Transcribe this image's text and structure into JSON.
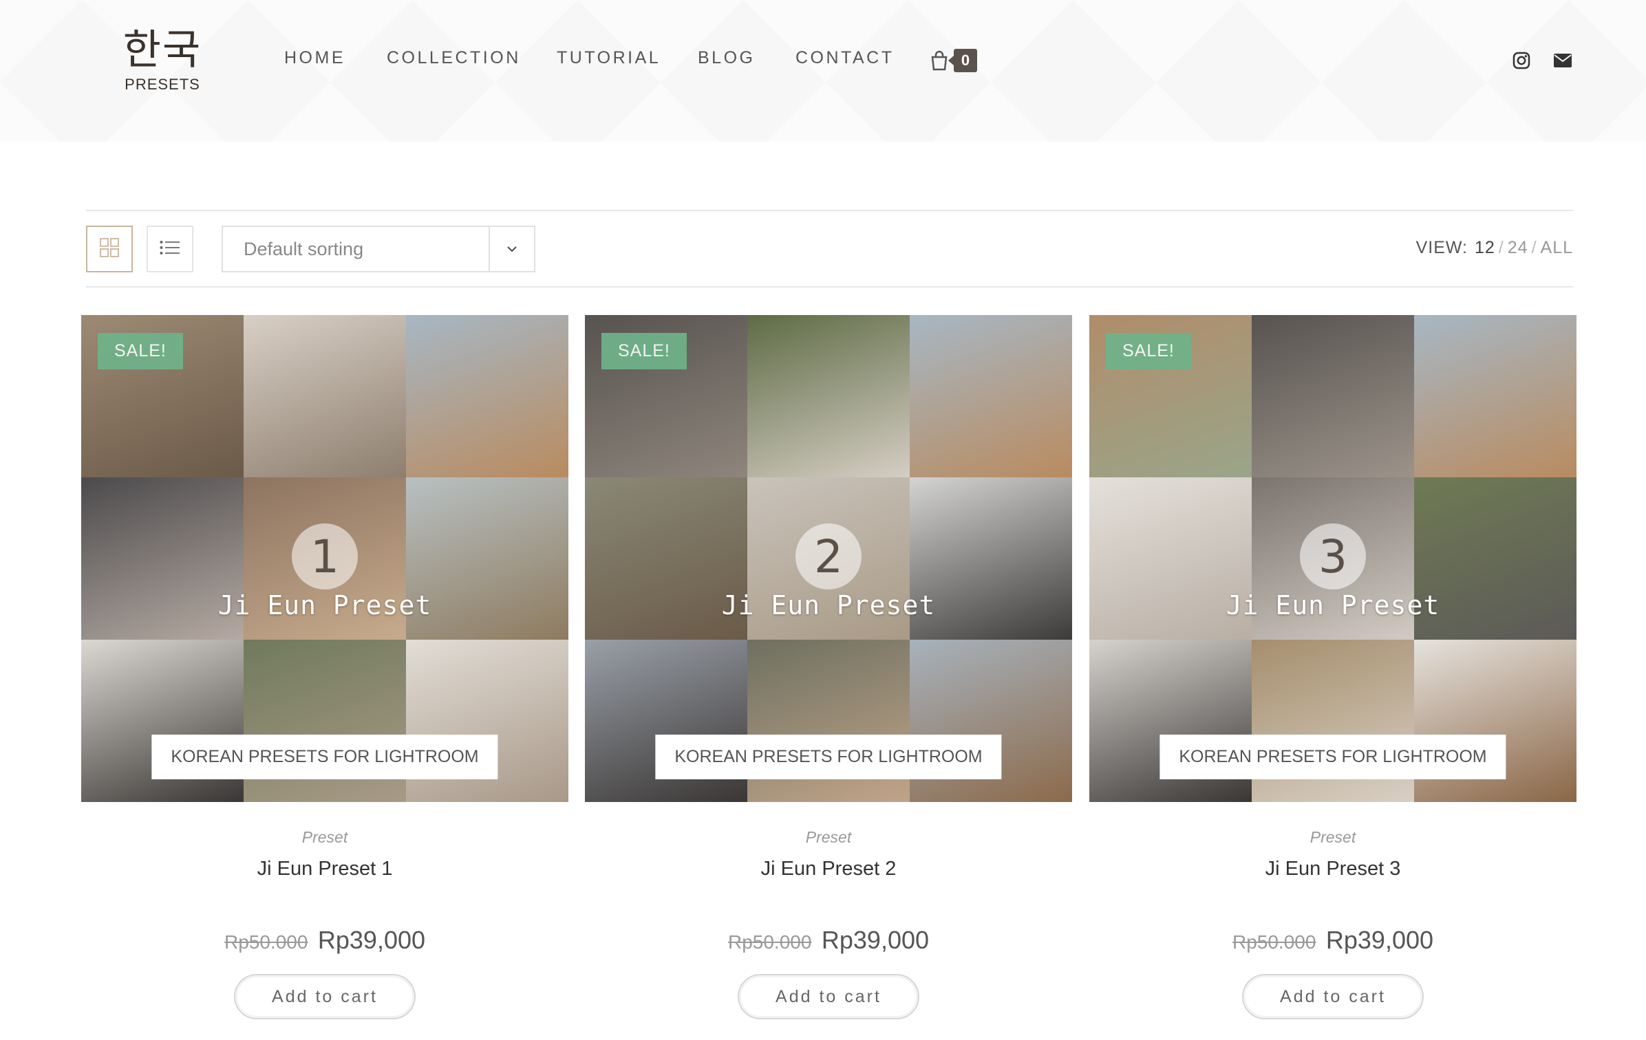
{
  "header": {
    "logo": {
      "korean": "한국",
      "sub": "PRESETS"
    },
    "nav": [
      {
        "label": "HOME"
      },
      {
        "label": "COLLECTION"
      },
      {
        "label": "TUTORIAL"
      },
      {
        "label": "BLOG"
      },
      {
        "label": "CONTACT"
      }
    ],
    "cart_count": "0",
    "social": [
      "instagram-icon",
      "envelope-icon"
    ]
  },
  "toolbar": {
    "sort_label": "Default sorting",
    "view_label": "VIEW:",
    "view_options": [
      "12",
      "24",
      "ALL"
    ],
    "view_current": "12"
  },
  "products": [
    {
      "sale_badge": "SALE!",
      "overlay_number": "1",
      "overlay_title": "Ji Eun Preset",
      "overlay_banner": "KOREAN PRESETS FOR LIGHTROOM",
      "category": "Preset",
      "name": "Ji Eun Preset 1",
      "price_old": "Rp50.000",
      "price_new": "Rp39,000",
      "button": "Add to cart"
    },
    {
      "sale_badge": "SALE!",
      "overlay_number": "2",
      "overlay_title": "Ji Eun Preset",
      "overlay_banner": "KOREAN PRESETS FOR LIGHTROOM",
      "category": "Preset",
      "name": "Ji Eun Preset 2",
      "price_old": "Rp50.000",
      "price_new": "Rp39,000",
      "button": "Add to cart"
    },
    {
      "sale_badge": "SALE!",
      "overlay_number": "3",
      "overlay_title": "Ji Eun Preset",
      "overlay_banner": "KOREAN PRESETS FOR LIGHTROOM",
      "category": "Preset",
      "name": "Ji Eun Preset 3",
      "price_old": "Rp50.000",
      "price_new": "Rp39,000",
      "button": "Add to cart"
    }
  ],
  "colors": {
    "sale_badge": "#6fb38a",
    "cart_badge": "#5a524c",
    "active_view_border": "#c8b59e"
  }
}
